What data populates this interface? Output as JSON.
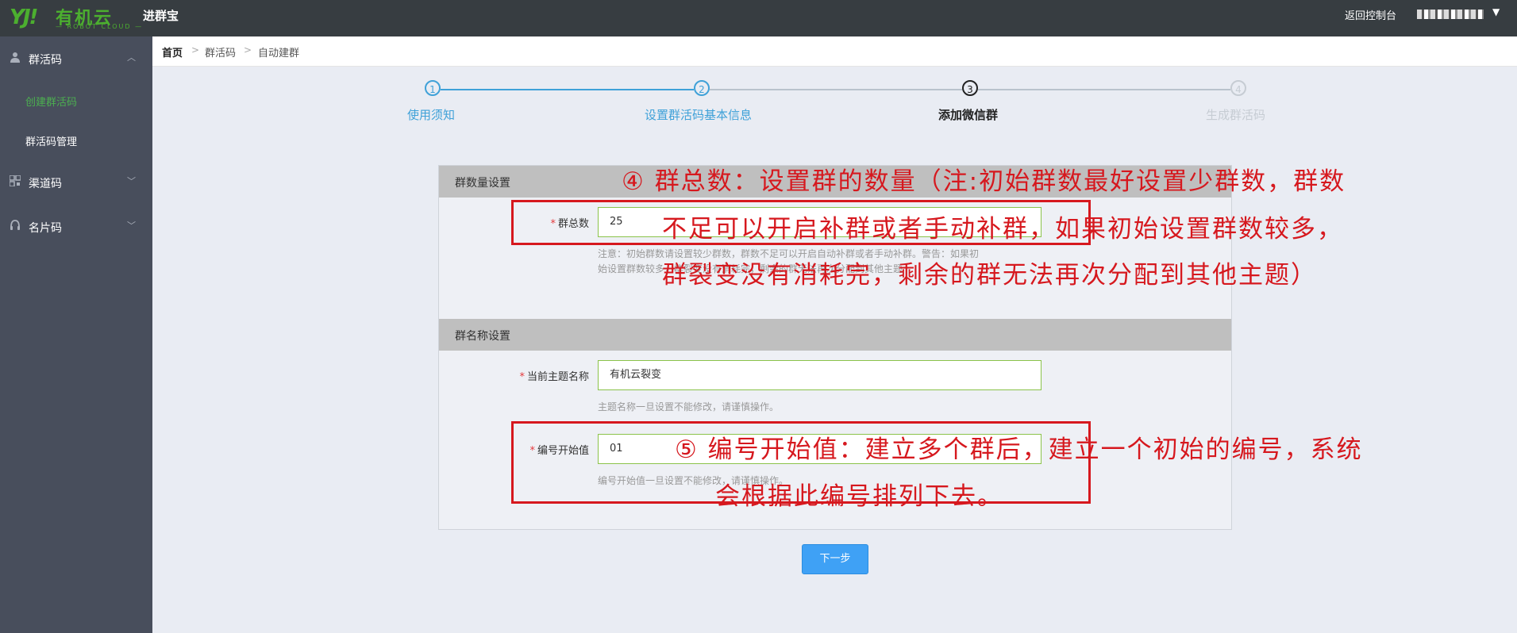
{
  "topbar": {
    "logo_mark": "YJ!",
    "logo_cn": "有机云",
    "logo_en": "— ROBOT CLOUD —",
    "product": "进群宝",
    "back_label": "返回控制台",
    "caret": "▼"
  },
  "sidebar": {
    "groups": [
      {
        "label": "群活码",
        "icon": "user-icon",
        "chevron": "︿"
      },
      {
        "label": "渠道码",
        "icon": "qr-grid-icon",
        "chevron": "﹀"
      },
      {
        "label": "名片码",
        "icon": "headset-icon",
        "chevron": "﹀"
      }
    ],
    "sub_items": [
      "创建群活码",
      "群活码管理"
    ]
  },
  "breadcrumb": [
    "首页",
    "群活码",
    "自动建群"
  ],
  "steps": [
    {
      "num": "1",
      "label": "使用须知",
      "state": "done"
    },
    {
      "num": "2",
      "label": "设置群活码基本信息",
      "state": "done"
    },
    {
      "num": "3",
      "label": "添加微信群",
      "state": "current"
    },
    {
      "num": "4",
      "label": "生成群活码",
      "state": "pending"
    }
  ],
  "form": {
    "section1_title": "群数量设置",
    "total_label": "群总数",
    "total_value": "25",
    "total_hint_1": "注意：初始群数请设置较少群数，群数不足可以开启自动补群或者手动补群。警告：如果初",
    "total_hint_2": "始设置群数较多，群裂变没有消耗完，剩余的群无法再次分配到其他主题",
    "section2_title": "群名称设置",
    "theme_label": "当前主题名称",
    "theme_value": "有机云裂变",
    "theme_hint": "主题名称一旦设置不能修改，请谨慎操作。",
    "start_label": "编号开始值",
    "start_value": "01",
    "start_hint": "编号开始值一旦设置不能修改，请谨慎操作。",
    "required_mark": "*"
  },
  "next_button": "下一步",
  "annotations": {
    "note4_line1": "④ 群总数：设置群的数量（注:初始群数最好设置少群数，群数",
    "note4_line2": "不足可以开启补群或者手动补群，如果初始设置群数较多，",
    "note4_line3": "群裂变没有消耗完，剩余的群无法再次分配到其他主题）",
    "note5_line1": "⑤ 编号开始值：建立多个群后，建立一个初始的编号，系统",
    "note5_line2": "会根据此编号排列下去。"
  },
  "colors": {
    "topbar": "#373d41",
    "sidebar": "#484e5c",
    "brand_green": "#4caf2f",
    "step_blue": "#3fa1d8",
    "annotation_red": "#d6181e",
    "button_blue": "#3fa1f5"
  }
}
